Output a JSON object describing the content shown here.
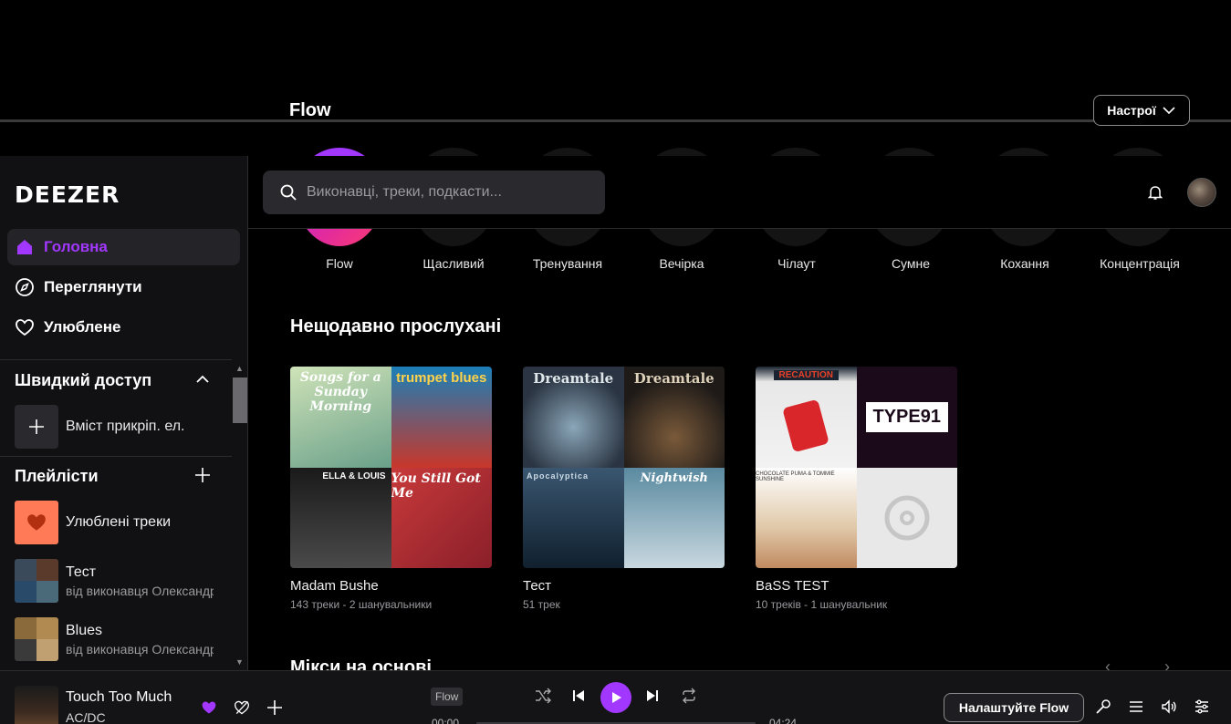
{
  "top_band": {
    "title": "Flow",
    "settings_label": "Настрої"
  },
  "sidebar": {
    "logo": "DEEZER",
    "nav": [
      {
        "label": "Головна",
        "icon": "home-icon",
        "active": true
      },
      {
        "label": "Переглянути",
        "icon": "compass-icon",
        "active": false
      },
      {
        "label": "Улюблене",
        "icon": "heart-icon",
        "active": false
      }
    ],
    "quick_access": {
      "heading": "Швидкий доступ",
      "pin_label": "Вміст прикріп. ел."
    },
    "playlists": {
      "heading": "Плейлісти",
      "items": [
        {
          "name": "Улюблені треки",
          "subtitle": ""
        },
        {
          "name": "Тест",
          "subtitle": "від виконавця Олександр"
        },
        {
          "name": "Blues",
          "subtitle": "від виконавця Олександр"
        }
      ]
    }
  },
  "header": {
    "search_placeholder": "Виконавці, треки, подкасти..."
  },
  "main": {
    "moods": [
      "Flow",
      "Щасливий",
      "Тренування",
      "Вечірка",
      "Чілаут",
      "Сумне",
      "Кохання",
      "Концентрація"
    ],
    "recent": {
      "title": "Нещодавно прослухані",
      "cards": [
        {
          "name": "Madam Bushe",
          "subtitle": "143 треки - 2 шанувальники",
          "covers": [
            "Songs for a Sunday Morning",
            "trumpet blues",
            "ELLA & LOUIS",
            "You Still Got Me"
          ]
        },
        {
          "name": "Тест",
          "subtitle": "51 трек",
          "covers": [
            "Dreamtale",
            "Dreamtale",
            "Apocalyptica",
            "Nightwish"
          ]
        },
        {
          "name": "BaSS TEST",
          "subtitle": "10 треків - 1 шанувальник",
          "covers": [
            "RECAUTION",
            "TYPE91",
            "CHOCOLATE PUMA & TOMMIE SUNSHINE",
            ""
          ]
        }
      ]
    },
    "mixes_title": "Мікси на основі"
  },
  "player": {
    "track": "Touch Too Much",
    "artist": "AC/DC",
    "context": "Flow",
    "time_elapsed": "00:00",
    "time_total": "04:24",
    "progress": 0,
    "cta_label": "Налаштуйте Flow",
    "accent": "#a238ff"
  }
}
